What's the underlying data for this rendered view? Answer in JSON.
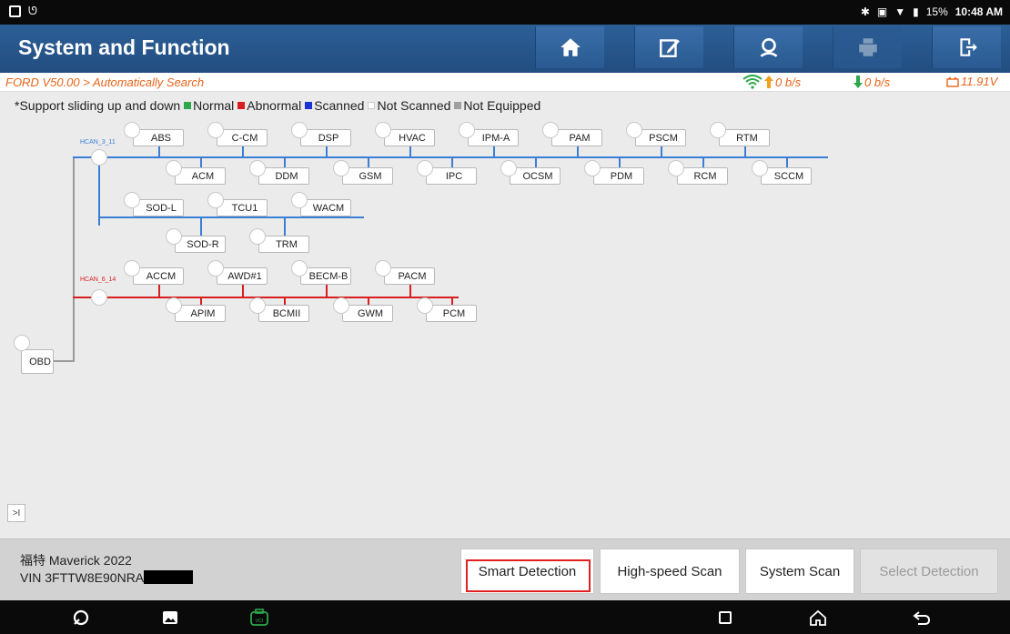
{
  "status_bar": {
    "battery": "15%",
    "time": "10:48 AM"
  },
  "header": {
    "title": "System and Function",
    "buttons": [
      {
        "icon": "home-icon"
      },
      {
        "icon": "edit-icon"
      },
      {
        "icon": "support-icon"
      },
      {
        "icon": "print-icon"
      },
      {
        "icon": "exit-icon"
      }
    ]
  },
  "breadcrumb": {
    "path": "FORD V50.00 > Automatically Search",
    "upload_rate": "0 b/s",
    "download_rate": "0 b/s",
    "voltage": "11.91V"
  },
  "legend": {
    "intro": "*Support sliding up and down",
    "items": [
      {
        "label": "Normal",
        "color": "#2aa84a"
      },
      {
        "label": "Abnormal",
        "color": "#d81e1e"
      },
      {
        "label": "Scanned",
        "color": "#1a33d9"
      },
      {
        "label": "Not Scanned",
        "color": "#ffffff"
      },
      {
        "label": "Not Equipped",
        "color": "#a0a0a0"
      }
    ]
  },
  "diagram": {
    "root": "OBD",
    "buses": [
      {
        "name": "HCAN_3_11",
        "color": "#3a7fd5",
        "top_row_1": [
          "ABS",
          "C-CM",
          "DSP",
          "HVAC",
          "IPM-A",
          "PAM",
          "PSCM",
          "RTM"
        ],
        "bottom_row_1": [
          "ACM",
          "DDM",
          "GSM",
          "IPC",
          "OCSM",
          "PDM",
          "RCM",
          "SCCM"
        ],
        "top_row_2": [
          "SOD-L",
          "TCU1",
          "WACM"
        ],
        "bottom_row_2": [
          "SOD-R",
          "TRM"
        ]
      },
      {
        "name": "HCAN_6_14",
        "color": "#d81e1e",
        "top_row_1": [
          "ACCM",
          "AWD#1",
          "BECM-B",
          "PACM"
        ],
        "bottom_row_1": [
          "APIM",
          "BCMII",
          "GWM",
          "PCM"
        ]
      }
    ]
  },
  "vehicle": {
    "name": "福特 Maverick 2022",
    "vin": "VIN 3FTTW8E90NRA"
  },
  "actions": {
    "smart_detection": "Smart Detection",
    "high_speed_scan": "High-speed Scan",
    "system_scan": "System Scan",
    "select_detection": "Select Detection"
  },
  "collapse_label": ">I"
}
